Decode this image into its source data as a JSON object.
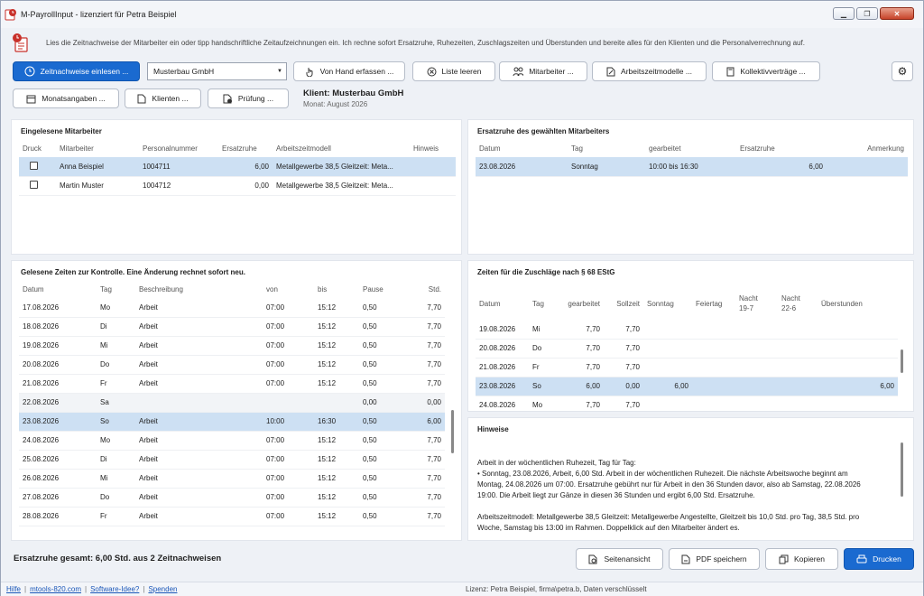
{
  "window": {
    "title": "M-PayrollInput - lizenziert für Petra Beispiel"
  },
  "description": "Lies die Zeitnachweise der Mitarbeiter ein oder tipp handschriftliche Zeitaufzeichnungen ein. Ich rechne sofort Ersatzruhe, Ruhezeiten, Zuschlagszeiten und Überstunden und bereite alles für den Klienten und die Personalverrechnung auf.",
  "toolbar": {
    "read_btn": "Zeitnachweise einlesen ...",
    "client_value": "Musterbau GmbH",
    "manual_btn": "Von Hand erfassen ...",
    "clear_btn": "Liste leeren",
    "employees_btn": "Mitarbeiter ...",
    "models_btn": "Arbeitszeitmodelle ...",
    "collective_btn": "Kollektivverträge ...",
    "month_btn": "Monatsangaben ...",
    "clients_btn": "Klienten ...",
    "check_btn": "Prüfung ..."
  },
  "client_info": {
    "label": "Klient:  Musterbau GmbH",
    "month": "Monat:  August 2026"
  },
  "employees": {
    "title": "Eingelesene Mitarbeiter",
    "headers": [
      "Druck",
      "Mitarbeiter",
      "Personalnummer",
      "Ersatzruhe",
      "Arbeitszeitmodell",
      "Hinweis"
    ],
    "rows": [
      [
        "Anna Beispiel",
        "1004711",
        "6,00",
        "Metallgewerbe 38,5 Gleitzeit: Meta..."
      ],
      [
        "Martin Muster",
        "1004712",
        "0,00",
        "Metallgewerbe 38,5 Gleitzeit: Meta..."
      ]
    ]
  },
  "ersatz": {
    "title": "Ersatzruhe des gewählten Mitarbeiters",
    "headers": [
      "Datum",
      "Tag",
      "gearbeitet",
      "Ersatzruhe",
      "Anmerkung"
    ],
    "rows": [
      [
        "23.08.2026",
        "Sonntag",
        "10:00 bis 16:30",
        "6,00",
        ""
      ]
    ]
  },
  "times": {
    "title": "Gelesene Zeiten zur Kontrolle. Eine Änderung rechnet sofort neu.",
    "headers": [
      "Datum",
      "Tag",
      "Beschreibung",
      "von",
      "bis",
      "Pause",
      "Std."
    ],
    "rows": [
      [
        "17.08.2026",
        "Mo",
        "Arbeit",
        "07:00",
        "15:12",
        "0,50",
        "7,70"
      ],
      [
        "18.08.2026",
        "Di",
        "Arbeit",
        "07:00",
        "15:12",
        "0,50",
        "7,70"
      ],
      [
        "19.08.2026",
        "Mi",
        "Arbeit",
        "07:00",
        "15:12",
        "0,50",
        "7,70"
      ],
      [
        "20.08.2026",
        "Do",
        "Arbeit",
        "07:00",
        "15:12",
        "0,50",
        "7,70"
      ],
      [
        "21.08.2026",
        "Fr",
        "Arbeit",
        "07:00",
        "15:12",
        "0,50",
        "7,70"
      ],
      [
        "22.08.2026",
        "Sa",
        "",
        "",
        "",
        "0,00",
        "0,00"
      ],
      [
        "23.08.2026",
        "So",
        "Arbeit",
        "10:00",
        "16:30",
        "0,50",
        "6,00"
      ],
      [
        "24.08.2026",
        "Mo",
        "Arbeit",
        "07:00",
        "15:12",
        "0,50",
        "7,70"
      ],
      [
        "25.08.2026",
        "Di",
        "Arbeit",
        "07:00",
        "15:12",
        "0,50",
        "7,70"
      ],
      [
        "26.08.2026",
        "Mi",
        "Arbeit",
        "07:00",
        "15:12",
        "0,50",
        "7,70"
      ],
      [
        "27.08.2026",
        "Do",
        "Arbeit",
        "07:00",
        "15:12",
        "0,50",
        "7,70"
      ],
      [
        "28.08.2026",
        "Fr",
        "Arbeit",
        "07:00",
        "15:12",
        "0,50",
        "7,70"
      ]
    ]
  },
  "surcharge": {
    "title": "Zeiten für die Zuschläge nach § 68 EStG",
    "headers": [
      "Datum",
      "Tag",
      "gearbeitet",
      "Sollzeit",
      "Sonntag",
      "Feiertag",
      "Nacht\n19-7",
      "Nacht\n22-6",
      "Überstunden"
    ],
    "rows": [
      [
        "19.08.2026",
        "Mi",
        "7,70",
        "7,70",
        "",
        "",
        "",
        "",
        ""
      ],
      [
        "20.08.2026",
        "Do",
        "7,70",
        "7,70",
        "",
        "",
        "",
        "",
        ""
      ],
      [
        "21.08.2026",
        "Fr",
        "7,70",
        "7,70",
        "",
        "",
        "",
        "",
        ""
      ],
      [
        "23.08.2026",
        "So",
        "6,00",
        "0,00",
        "6,00",
        "",
        "",
        "",
        "6,00"
      ],
      [
        "24.08.2026",
        "Mo",
        "7,70",
        "7,70",
        "",
        "",
        "",
        "",
        ""
      ]
    ]
  },
  "hints": {
    "title": "Hinweise",
    "p1_lines": [
      "Arbeit in der wöchentlichen Ruhezeit, Tag für Tag:",
      "• Sonntag, 23.08.2026, Arbeit, 6,00 Std. Arbeit in der wöchentlichen Ruhezeit. Die nächste Arbeitswoche beginnt am",
      "Montag, 24.08.2026 um 07:00. Ersatzruhe gebührt nur für Arbeit in den 36 Stunden davor, also ab Samstag, 22.08.2026",
      "19:00. Die Arbeit liegt zur Gänze in diesen 36 Stunden und ergibt 6,00 Std. Ersatzruhe."
    ],
    "p2_lines": [
      "Arbeitszeitmodell: Metallgewerbe 38,5 Gleitzeit: Metallgewerbe Angestellte, Gleitzeit bis 10,0 Std. pro Tag, 38,5 Std. pro",
      "Woche, Samstag bis 13:00 im Rahmen. Doppelklick auf den Mitarbeiter ändert es."
    ]
  },
  "footer": {
    "total": "Ersatzruhe gesamt: 6,00 Std. aus 2 Zeitnachweisen",
    "page_btn": "Seitenansicht",
    "pdf_btn": "PDF speichern",
    "copy_btn": "Kopieren",
    "print_btn": "Drucken"
  },
  "status": {
    "link_help": "Hilfe",
    "link_site": "mtools-820.com",
    "link_idea": "Software-Idee?",
    "link_donate": "Spenden",
    "sep": "|",
    "license": "Lizenz: Petra Beispiel, firma\\petra.b, Daten verschlüsselt"
  }
}
